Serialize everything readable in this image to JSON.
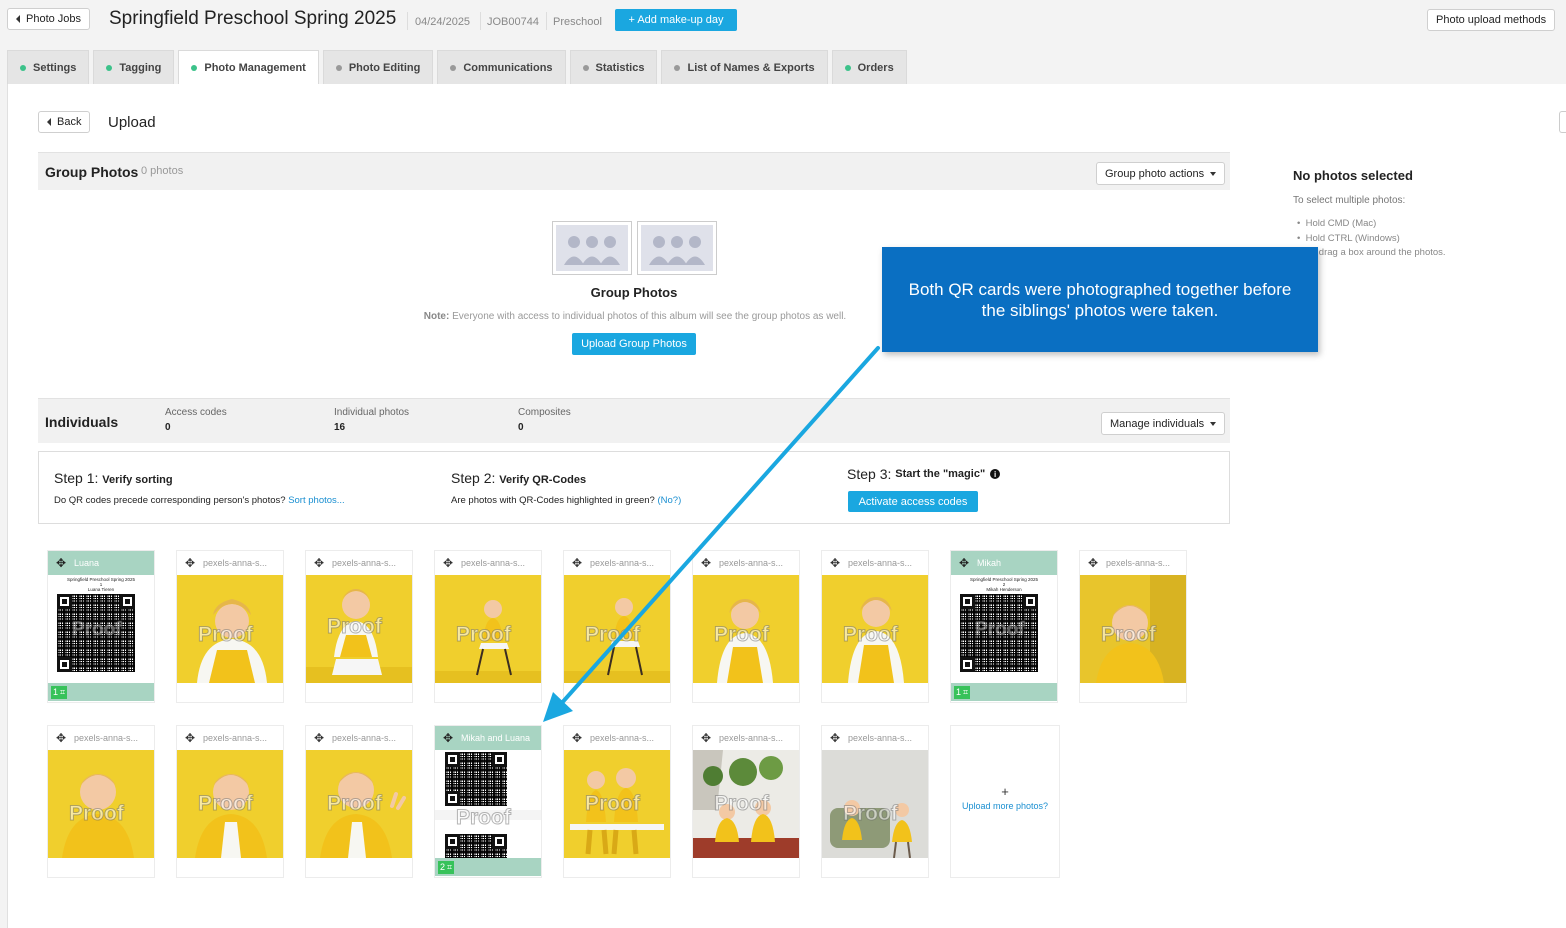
{
  "header": {
    "back_label": "Photo Jobs",
    "title": "Springfield Preschool Spring 2025",
    "date": "04/24/2025",
    "job_id": "JOB00744",
    "category": "Preschool",
    "makeup_label": "+ Add make-up day",
    "upload_methods_label": "Photo upload methods"
  },
  "tabs": [
    {
      "label": "Settings",
      "dot": "#3cc28a"
    },
    {
      "label": "Tagging",
      "dot": "#3cc28a"
    },
    {
      "label": "Photo Management",
      "dot": "#3cc28a"
    },
    {
      "label": "Photo Editing",
      "dot": "#999999"
    },
    {
      "label": "Communications",
      "dot": "#999999"
    },
    {
      "label": "Statistics",
      "dot": "#999999"
    },
    {
      "label": "List of Names & Exports",
      "dot": "#999999"
    },
    {
      "label": "Orders",
      "dot": "#3cc28a"
    }
  ],
  "page": {
    "back_label": "Back",
    "title": "Upload"
  },
  "group_photos": {
    "title": "Group Photos",
    "count": "0 photos",
    "actions_label": "Group photo actions",
    "empty_title": "Group Photos",
    "note_label": "Note:",
    "note_text": "Everyone with access to individual photos of this album will see the group photos as well.",
    "upload_label": "Upload Group Photos"
  },
  "individuals": {
    "title": "Individuals",
    "stats": [
      {
        "label": "Access codes",
        "value": "0"
      },
      {
        "label": "Individual photos",
        "value": "16"
      },
      {
        "label": "Composites",
        "value": "0"
      }
    ],
    "manage_label": "Manage individuals"
  },
  "steps": [
    {
      "prefix": "Step 1:",
      "title": "Verify sorting",
      "desc": "Do QR codes precede corresponding person's photos?",
      "link": "Sort photos..."
    },
    {
      "prefix": "Step 2:",
      "title": "Verify QR-Codes",
      "desc": "Are photos with QR-Codes highlighted in green?",
      "link": "(No?)"
    },
    {
      "prefix": "Step 3:",
      "title": "Start the \"magic\"",
      "button": "Activate access codes"
    }
  ],
  "side": {
    "title": "No photos selected",
    "hint": "To select multiple photos:",
    "items": [
      "Hold CMD (Mac)",
      "Hold CTRL (Windows)",
      "Or drag a box around the photos."
    ]
  },
  "callout": "Both QR cards were photographed together before the siblings' photos were taken.",
  "photos": {
    "proof": "Proof",
    "generic_name": "pexels-anna-s...",
    "qr1": {
      "name": "Luana",
      "line1": "Springfield Preschool Spring 2025",
      "line2": "1",
      "line3": "Luana Tieren",
      "badge": "1"
    },
    "qr2": {
      "name": "Mikah",
      "line1": "Springfield Preschool Spring 2025",
      "line2": "2",
      "line3": "Mikah Henderson",
      "badge": "1"
    },
    "qr3": {
      "name": "Mikah and Luana",
      "badge": "2"
    },
    "upload_more": "Upload more photos?",
    "upload_plus": "+"
  },
  "colors": {
    "accent": "#1aa7e0",
    "qr_green": "#a8d4c2",
    "callout": "#0a6fc2",
    "arrow": "#1aa7e0"
  }
}
